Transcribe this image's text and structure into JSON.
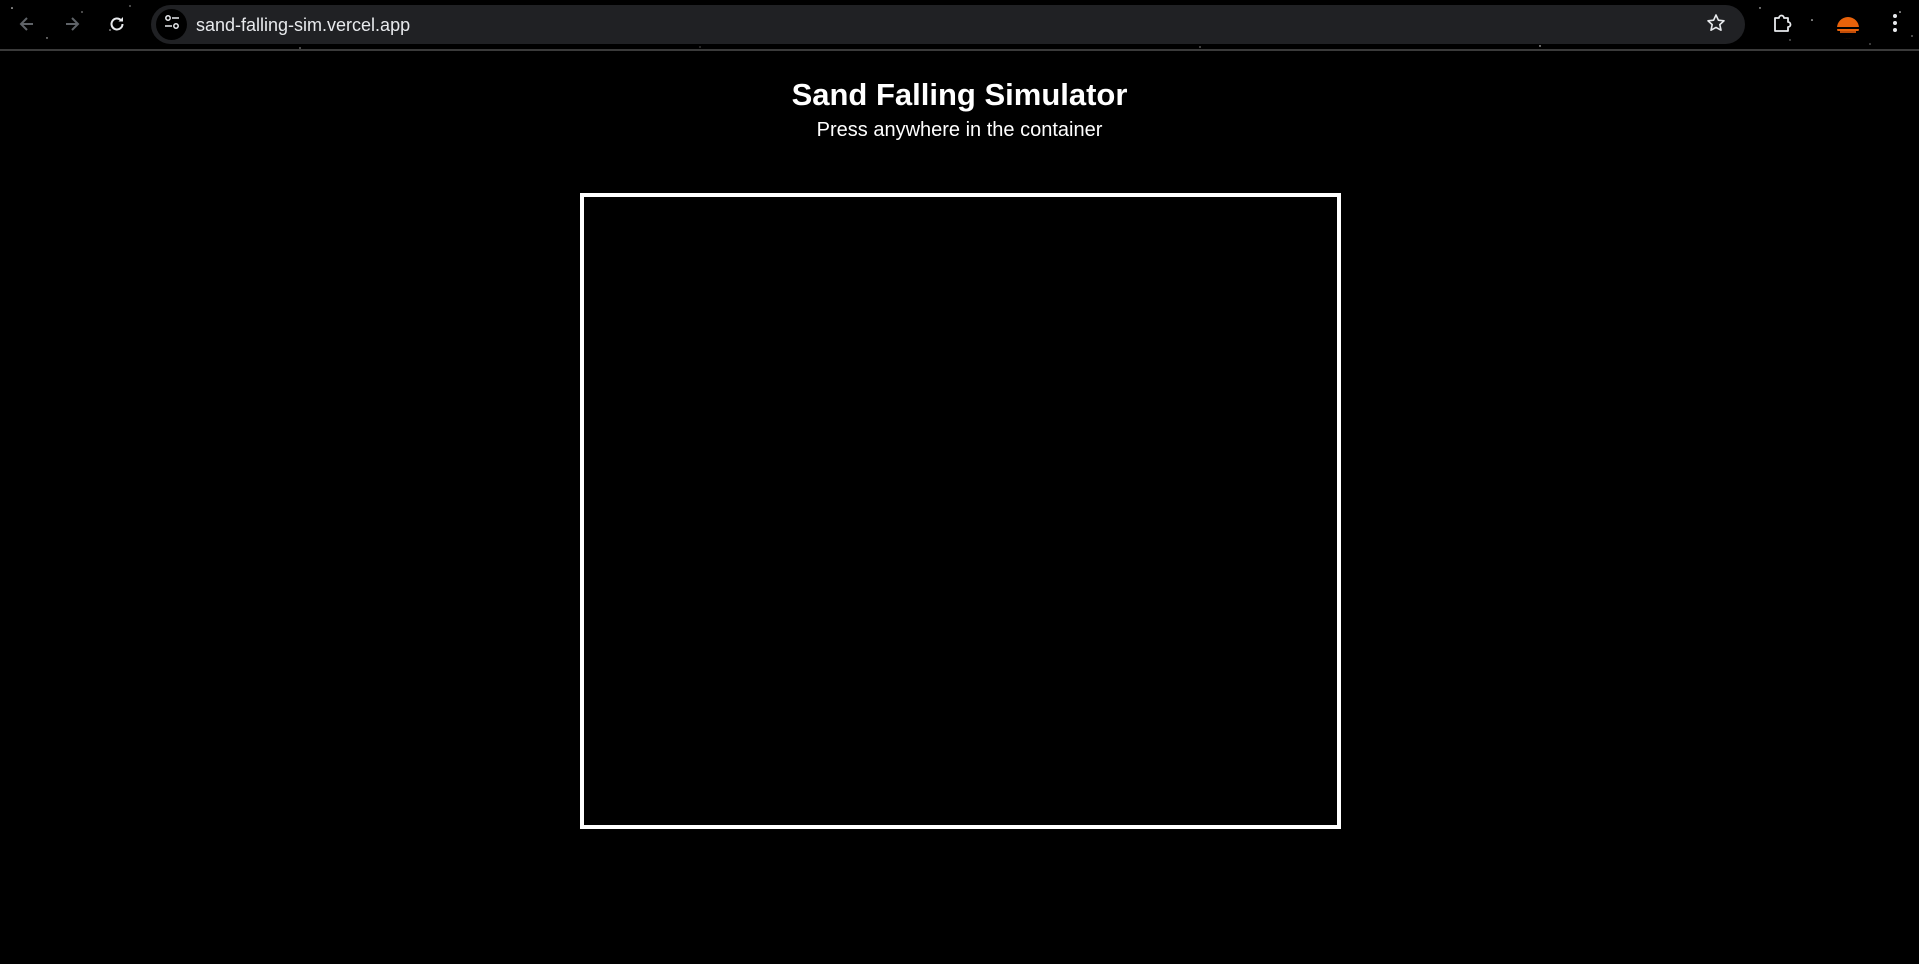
{
  "browser": {
    "url": "sand-falling-sim.vercel.app",
    "icons": {
      "back": "arrow-left-icon",
      "forward": "arrow-right-icon",
      "reload": "reload-icon",
      "site_info": "tune-icon",
      "bookmark": "star-icon",
      "extensions": "puzzle-icon",
      "profile": "avatar",
      "menu": "kebab-menu-icon"
    },
    "colors": {
      "toolbar": "#000000",
      "omnibox": "#202124",
      "url_text": "#e8eaed"
    }
  },
  "page": {
    "title": "Sand Falling Simulator",
    "subtitle": "Press anywhere in the container",
    "colors": {
      "background": "#000000",
      "text": "#ffffff",
      "container_border": "#ffffff"
    }
  }
}
